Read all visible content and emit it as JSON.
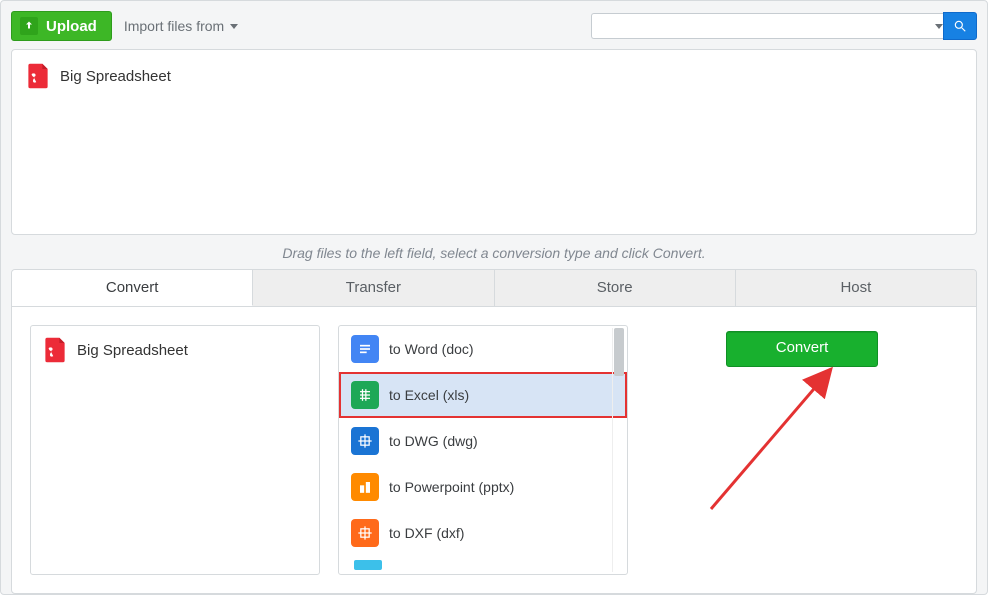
{
  "toolbar": {
    "upload_label": "Upload",
    "import_label": "Import files from",
    "search_placeholder": ""
  },
  "dropzone": {
    "file_name": "Big Spreadsheet"
  },
  "hint": "Drag files to the left field, select a conversion type and click Convert.",
  "tabs": {
    "items": [
      "Convert",
      "Transfer",
      "Store",
      "Host"
    ],
    "active_index": 0
  },
  "left_col": {
    "file_name": "Big Spreadsheet"
  },
  "formats": [
    {
      "label": "to Word (doc)",
      "icon": "word"
    },
    {
      "label": "to Excel (xls)",
      "icon": "excel",
      "selected": true
    },
    {
      "label": "to DWG (dwg)",
      "icon": "dwg"
    },
    {
      "label": "to Powerpoint (pptx)",
      "icon": "ppt"
    },
    {
      "label": "to DXF (dxf)",
      "icon": "dxf"
    }
  ],
  "actions": {
    "convert_label": "Convert"
  }
}
